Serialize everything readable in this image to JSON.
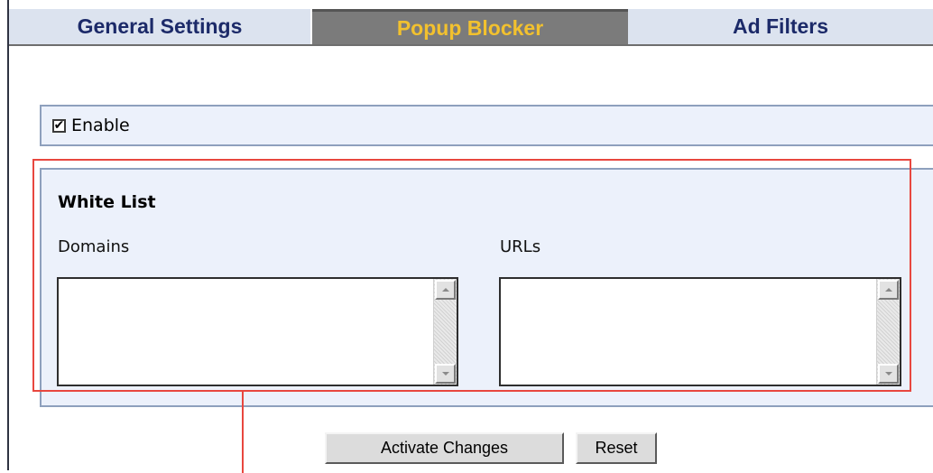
{
  "tabs": {
    "general": "General Settings",
    "popup": "Popup Blocker",
    "ads": "Ad Filters",
    "active": "Popup Blocker"
  },
  "enable": {
    "label": "Enable",
    "checked": true,
    "check_glyph": "✔"
  },
  "whitelist": {
    "title": "White List",
    "domains_label": "Domains",
    "urls_label": "URLs",
    "domains_value": "",
    "urls_value": ""
  },
  "buttons": {
    "activate": "Activate Changes",
    "reset": "Reset"
  },
  "colors": {
    "tab_active_bg": "#7b7b7b",
    "tab_active_text": "#f2c12e",
    "tab_inactive_bg": "#dce3ef",
    "tab_inactive_text": "#1c2a69",
    "panel_bg": "#ecf1fb",
    "highlight": "#e8473f"
  }
}
